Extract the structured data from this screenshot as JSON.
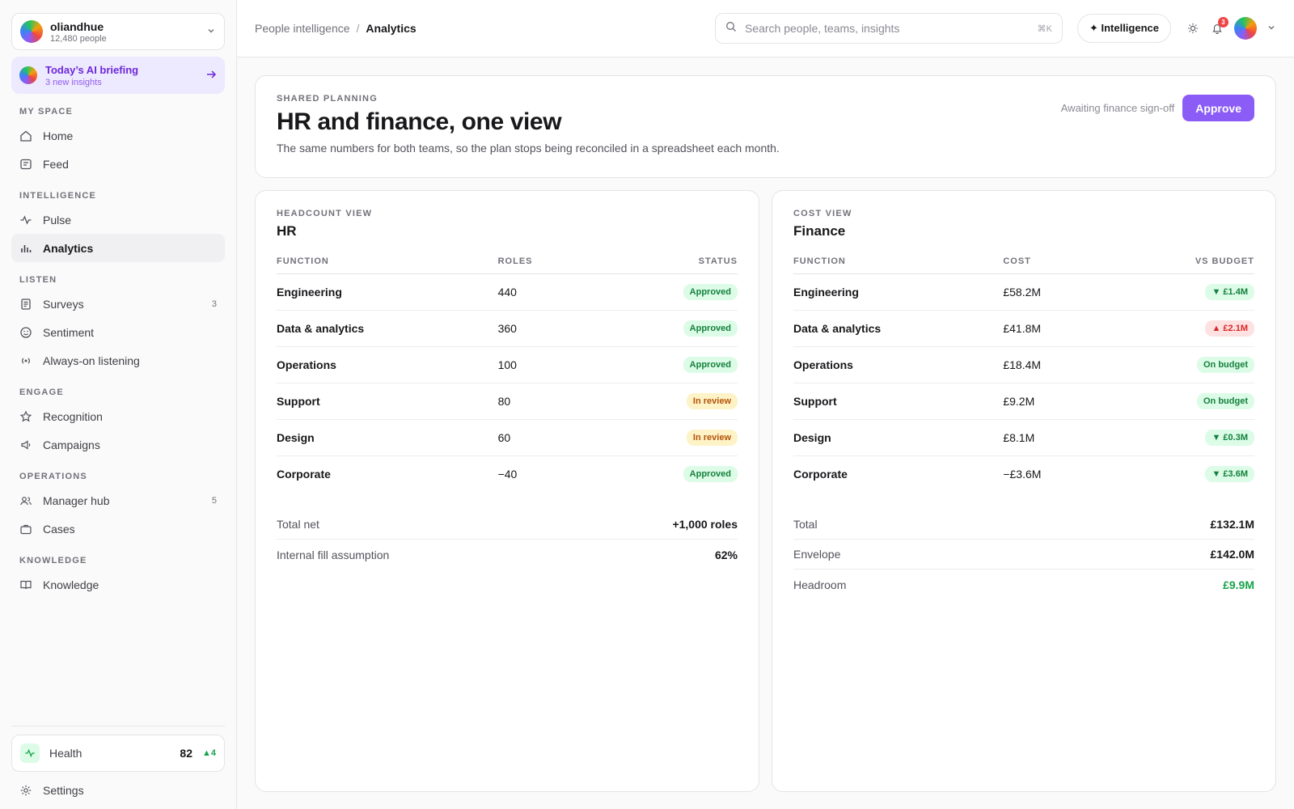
{
  "sidebar": {
    "org": {
      "name": "oliandhue",
      "sub": "12,480 people"
    },
    "briefing": {
      "title": "Today’s AI briefing",
      "sub": "3 new insights"
    },
    "sections": {
      "my_space": "MY SPACE",
      "intelligence": "INTELLIGENCE",
      "listen": "LISTEN",
      "engage": "ENGAGE",
      "operations": "OPERATIONS",
      "knowledge": "KNOWLEDGE"
    },
    "items": {
      "home": "Home",
      "feed": "Feed",
      "pulse": "Pulse",
      "analytics": "Analytics",
      "surveys": "Surveys",
      "surveys_count": "3",
      "sentiment": "Sentiment",
      "listening": "Always-on listening",
      "recognition": "Recognition",
      "campaigns": "Campaigns",
      "manager_hub": "Manager hub",
      "manager_hub_count": "5",
      "cases": "Cases",
      "knowledge": "Knowledge"
    },
    "health": {
      "label": "Health",
      "score": "82",
      "delta": "▲4"
    },
    "settings": "Settings"
  },
  "topbar": {
    "crumb_parent": "People intelligence",
    "crumb_sep": "/",
    "crumb_current": "Analytics",
    "search_placeholder": "Search people, teams, insights",
    "search_kbd": "⌘K",
    "intelligence_label": "✦ Intelligence",
    "notif_count": "3"
  },
  "hero": {
    "eyebrow": "SHARED PLANNING",
    "title": "HR and finance, one view",
    "subtitle": "The same numbers for both teams, so the plan stops being reconciled in a spreadsheet each month.",
    "status": "Awaiting finance sign-off",
    "approve_label": "Approve"
  },
  "hr": {
    "eyebrow": "HEADCOUNT VIEW",
    "title": "HR",
    "columns": [
      "FUNCTION",
      "ROLES",
      "STATUS"
    ],
    "rows": [
      {
        "function": "Engineering",
        "roles": "440",
        "status": "Approved"
      },
      {
        "function": "Data & analytics",
        "roles": "360",
        "status": "Approved"
      },
      {
        "function": "Operations",
        "roles": "100",
        "status": "Approved"
      },
      {
        "function": "Support",
        "roles": "80",
        "status": "In review"
      },
      {
        "function": "Design",
        "roles": "60",
        "status": "In review"
      },
      {
        "function": "Corporate",
        "roles": "−40",
        "status": "Approved"
      }
    ],
    "summary": [
      {
        "label": "Total net",
        "value": "+1,000 roles"
      },
      {
        "label": "Internal fill assumption",
        "value": "62%"
      }
    ]
  },
  "finance": {
    "eyebrow": "COST VIEW",
    "title": "Finance",
    "columns": [
      "FUNCTION",
      "COST",
      "VS BUDGET"
    ],
    "rows": [
      {
        "function": "Engineering",
        "cost": "£58.2M",
        "budget": "▼ £1.4M"
      },
      {
        "function": "Data & analytics",
        "cost": "£41.8M",
        "budget": "▲ £2.1M"
      },
      {
        "function": "Operations",
        "cost": "£18.4M",
        "budget": "On budget"
      },
      {
        "function": "Support",
        "cost": "£9.2M",
        "budget": "On budget"
      },
      {
        "function": "Design",
        "cost": "£8.1M",
        "budget": "▼ £0.3M"
      },
      {
        "function": "Corporate",
        "cost": "−£3.6M",
        "budget": "▼ £3.6M"
      }
    ],
    "summary": [
      {
        "label": "Total",
        "value": "£132.1M"
      },
      {
        "label": "Envelope",
        "value": "£142.0M"
      },
      {
        "label": "Headroom",
        "value": "£9.9M"
      }
    ]
  }
}
